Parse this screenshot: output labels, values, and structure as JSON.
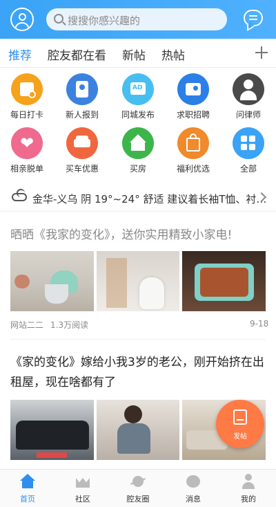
{
  "header": {
    "search_placeholder": "搜搜你感兴趣的"
  },
  "tabs": [
    {
      "label": "推荐",
      "active": true
    },
    {
      "label": "腔友都在看"
    },
    {
      "label": "新帖"
    },
    {
      "label": "热帖"
    }
  ],
  "features": [
    {
      "label": "每日打卡",
      "color": "#f7a21b",
      "icon": "calendar-check-icon"
    },
    {
      "label": "新人报到",
      "color": "#3b82e0",
      "icon": "contact-book-icon"
    },
    {
      "label": "同城发布",
      "color": "#46bff0",
      "icon": "ad-card-icon"
    },
    {
      "label": "求职招聘",
      "color": "#2b7fe6",
      "icon": "id-card-icon"
    },
    {
      "label": "问律师",
      "color": "#4a4a4a",
      "icon": "lawyer-icon"
    },
    {
      "label": "相亲脱单",
      "color": "#ef6a8e",
      "icon": "heart-icon"
    },
    {
      "label": "买车优惠",
      "color": "#f0673f",
      "icon": "car-icon"
    },
    {
      "label": "买房",
      "color": "#3cb54a",
      "icon": "house-icon"
    },
    {
      "label": "福利优选",
      "color": "#f08a2a",
      "icon": "gift-bag-icon"
    },
    {
      "label": "全部",
      "color": "#3aa3f5",
      "icon": "grid-icon"
    }
  ],
  "weather": {
    "text": "金华-义乌 阴 19°~24° 舒适 建议着长袖T恤、衬…"
  },
  "posts": [
    {
      "title": "晒晒《我家的变化》，送你实用精致小家电!",
      "author": "网站二二",
      "reads": "1.3万阅读",
      "date": "9-18"
    },
    {
      "title_line1": "《家的变化》嫁给小我3岁的老公，刚开始挤在出",
      "title_line2": "租屋，现在啥都有了"
    }
  ],
  "fab": {
    "label": "发帖"
  },
  "bottom_nav": [
    {
      "label": "首页",
      "active": true
    },
    {
      "label": "社区"
    },
    {
      "label": "腔友圈"
    },
    {
      "label": "消息"
    },
    {
      "label": "我的"
    }
  ],
  "colors": {
    "accent": "#2f8ff0",
    "header": "#3aa3f5",
    "fab": "#ff7a45"
  }
}
